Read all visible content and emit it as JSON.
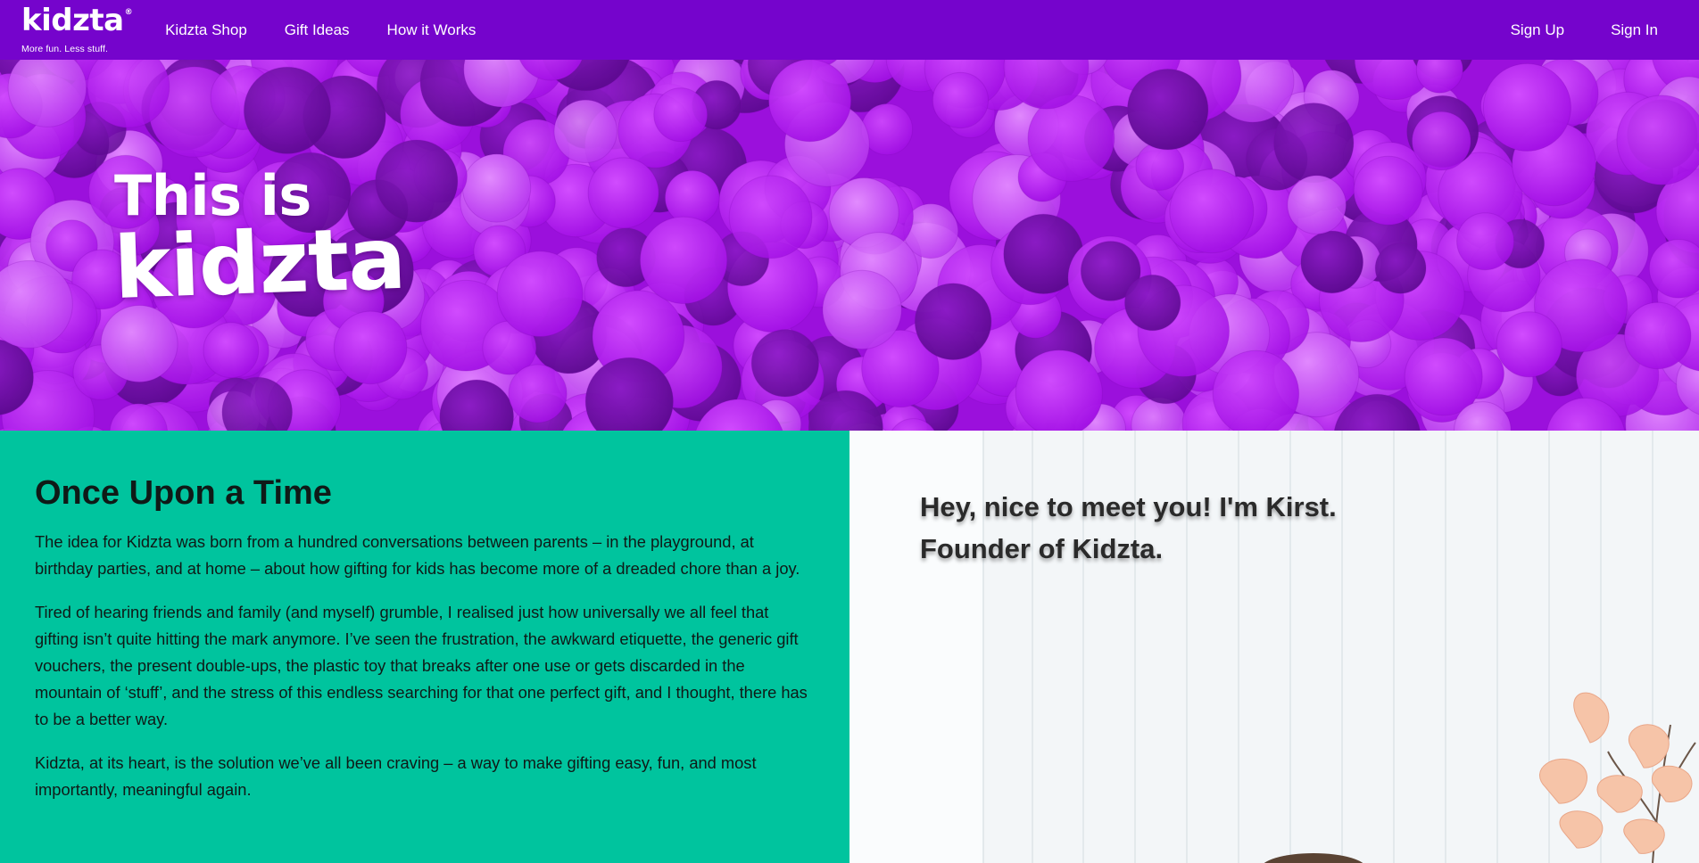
{
  "nav": {
    "logo_text": "kidzta",
    "logo_reg": "®",
    "tagline": "More fun. Less stuff.",
    "links": [
      {
        "label": "Kidzta Shop"
      },
      {
        "label": "Gift Ideas"
      },
      {
        "label": "How it Works"
      }
    ],
    "sign_up": "Sign Up",
    "sign_in": "Sign In"
  },
  "hero": {
    "line1": "This is",
    "line2": "kidzta"
  },
  "story": {
    "heading": "Once Upon a Time",
    "paragraphs": [
      "The idea for Kidzta was born from a hundred conversations between parents – in the playground, at birthday parties, and at home – about how gifting for kids has become more of a dreaded chore than a joy.",
      "Tired of hearing friends and family (and myself) grumble, I realised just how universally we all feel that gifting isn’t quite hitting the mark anymore. I’ve seen the frustration, the awkward etiquette, the generic gift vouchers, the present double-ups, the plastic toy that breaks after one use or gets discarded in the mountain of ‘stuff’, and the stress of this endless searching for that one perfect gift, and I thought, there has to be a better way.",
      "Kidzta, at its heart, is the solution we’ve all been craving – a way to make gifting easy, fun, and most importantly, meaningful again."
    ]
  },
  "founder": {
    "line1": "Hey, nice to meet you! I'm Kirst.",
    "line2": "Founder of Kidzta."
  },
  "colors": {
    "nav_bg": "#7504cc",
    "hero_bg": "#a300e8",
    "story_bg": "#00c49e",
    "founder_bg": "#f4f7f8"
  }
}
